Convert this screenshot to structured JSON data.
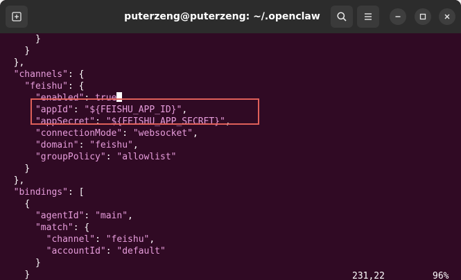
{
  "window": {
    "title": "puterzeng@puterzeng: ~/.openclaw"
  },
  "icons": {
    "new_tab": "new-tab-icon",
    "search": "search-icon",
    "menu": "hamburger-menu-icon",
    "minimize": "minimize-icon",
    "maximize": "maximize-icon",
    "close": "close-icon"
  },
  "colors": {
    "terminal_bg": "#300a24",
    "titlebar_bg": "#2c2c2c",
    "string_color": "#e79ddc",
    "highlight_box": "#e0605a"
  },
  "editor": {
    "lines": [
      {
        "indent": "      ",
        "parts": [
          {
            "t": "}",
            "c": "p"
          }
        ]
      },
      {
        "indent": "    ",
        "parts": [
          {
            "t": "}",
            "c": "p"
          }
        ]
      },
      {
        "indent": "  ",
        "parts": [
          {
            "t": "},",
            "c": "p"
          }
        ]
      },
      {
        "indent": "  ",
        "parts": [
          {
            "t": "\"channels\"",
            "c": "k"
          },
          {
            "t": ": {",
            "c": "p"
          }
        ]
      },
      {
        "indent": "    ",
        "parts": [
          {
            "t": "\"feishu\"",
            "c": "k"
          },
          {
            "t": ": {",
            "c": "p"
          }
        ]
      },
      {
        "indent": "      ",
        "parts": [
          {
            "t": "\"enabled\"",
            "c": "k"
          },
          {
            "t": ": ",
            "c": "p"
          },
          {
            "t": "true",
            "c": "v"
          },
          {
            "t": "",
            "c": "cursor"
          }
        ]
      },
      {
        "indent": "      ",
        "parts": [
          {
            "t": "\"appId\"",
            "c": "k"
          },
          {
            "t": ": ",
            "c": "p"
          },
          {
            "t": "\"${FEISHU_APP_ID}\"",
            "c": "v"
          },
          {
            "t": ",",
            "c": "p"
          }
        ]
      },
      {
        "indent": "      ",
        "parts": [
          {
            "t": "\"appSecret\"",
            "c": "k"
          },
          {
            "t": ": ",
            "c": "p"
          },
          {
            "t": "\"${FEISHU_APP_SECRET}\"",
            "c": "v"
          },
          {
            "t": ",",
            "c": "p"
          }
        ]
      },
      {
        "indent": "      ",
        "parts": [
          {
            "t": "\"connectionMode\"",
            "c": "k"
          },
          {
            "t": ": ",
            "c": "p"
          },
          {
            "t": "\"websocket\"",
            "c": "v"
          },
          {
            "t": ",",
            "c": "p"
          }
        ]
      },
      {
        "indent": "      ",
        "parts": [
          {
            "t": "\"domain\"",
            "c": "k"
          },
          {
            "t": ": ",
            "c": "p"
          },
          {
            "t": "\"feishu\"",
            "c": "v"
          },
          {
            "t": ",",
            "c": "p"
          }
        ]
      },
      {
        "indent": "      ",
        "parts": [
          {
            "t": "\"groupPolicy\"",
            "c": "k"
          },
          {
            "t": ": ",
            "c": "p"
          },
          {
            "t": "\"allowlist\"",
            "c": "v"
          }
        ]
      },
      {
        "indent": "    ",
        "parts": [
          {
            "t": "}",
            "c": "p"
          }
        ]
      },
      {
        "indent": "  ",
        "parts": [
          {
            "t": "},",
            "c": "p"
          }
        ]
      },
      {
        "indent": "  ",
        "parts": [
          {
            "t": "\"bindings\"",
            "c": "k"
          },
          {
            "t": ": [",
            "c": "p"
          }
        ]
      },
      {
        "indent": "    ",
        "parts": [
          {
            "t": "{",
            "c": "p"
          }
        ]
      },
      {
        "indent": "      ",
        "parts": [
          {
            "t": "\"agentId\"",
            "c": "k"
          },
          {
            "t": ": ",
            "c": "p"
          },
          {
            "t": "\"main\"",
            "c": "v"
          },
          {
            "t": ",",
            "c": "p"
          }
        ]
      },
      {
        "indent": "      ",
        "parts": [
          {
            "t": "\"match\"",
            "c": "k"
          },
          {
            "t": ": {",
            "c": "p"
          }
        ]
      },
      {
        "indent": "        ",
        "parts": [
          {
            "t": "\"channel\"",
            "c": "k"
          },
          {
            "t": ": ",
            "c": "p"
          },
          {
            "t": "\"feishu\"",
            "c": "v"
          },
          {
            "t": ",",
            "c": "p"
          }
        ]
      },
      {
        "indent": "        ",
        "parts": [
          {
            "t": "\"accountId\"",
            "c": "k"
          },
          {
            "t": ": ",
            "c": "p"
          },
          {
            "t": "\"default\"",
            "c": "v"
          }
        ]
      },
      {
        "indent": "      ",
        "parts": [
          {
            "t": "}",
            "c": "p"
          }
        ]
      },
      {
        "indent": "    ",
        "parts": [
          {
            "t": "}",
            "c": "p"
          }
        ]
      }
    ]
  },
  "status": {
    "position": "231,22",
    "percent": "96%"
  }
}
